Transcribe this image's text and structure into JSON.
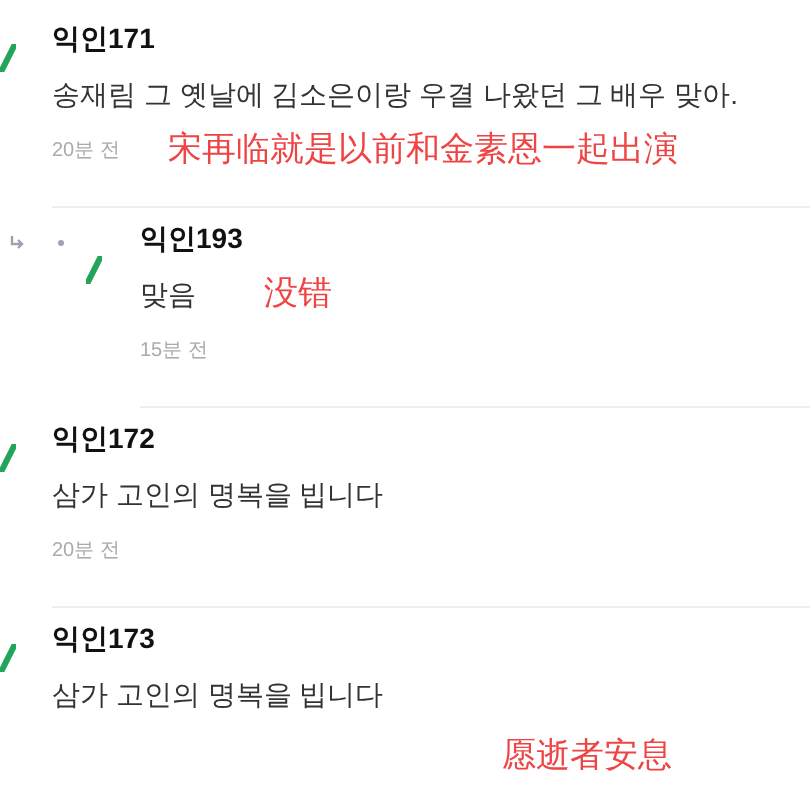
{
  "comments": [
    {
      "kind": "comment",
      "author": "익인171",
      "text": "송재림 그 옛날에 김소은이랑 우결 나왔던 그 배우 맞아.",
      "time": "20분 전",
      "annotation": "宋再临就是以前和金素恩一起出演"
    },
    {
      "kind": "reply",
      "author": "익인193",
      "text": "맞음",
      "time": "15분 전",
      "annotation": "没错"
    },
    {
      "kind": "comment",
      "author": "익인172",
      "text": "삼가 고인의 명복을 빕니다",
      "time": "20분 전"
    },
    {
      "kind": "comment",
      "author": "익인173",
      "text": "삼가 고인의 명복을 빕니다",
      "annotation": "愿逝者安息"
    }
  ]
}
